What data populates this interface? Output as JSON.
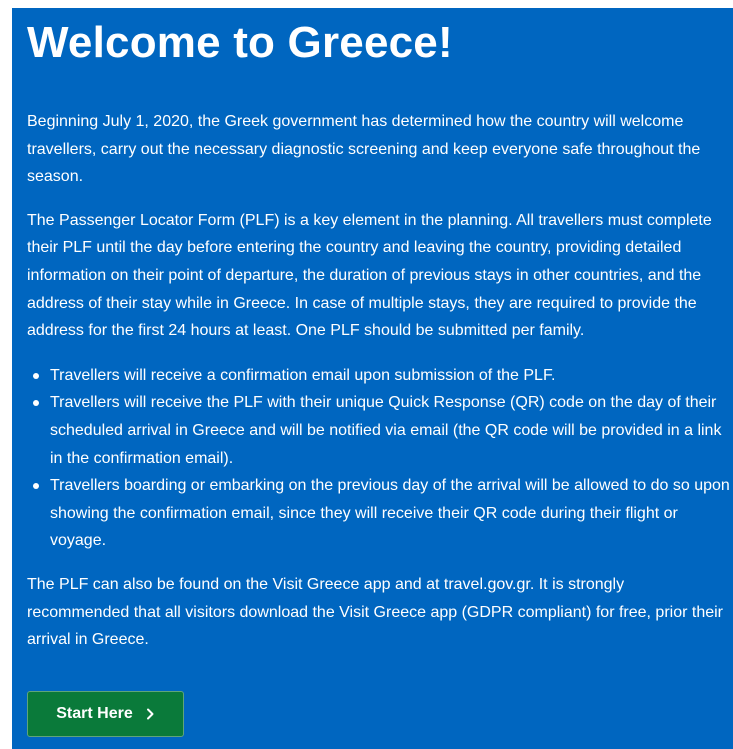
{
  "page": {
    "title": "Welcome to Greece!",
    "paragraphs": [
      "Beginning July 1, 2020, the Greek government has determined how the country will welcome travellers, carry out the necessary diagnostic screening and keep everyone safe throughout the season.",
      "The Passenger Locator Form (PLF) is a key element in the planning. All travellers must complete their PLF until the day before entering the country and leaving the country, providing detailed information on their point of departure, the duration of previous stays in other countries, and the address of their stay while in Greece. In case of multiple stays, they are required to provide the address for the first 24 hours at least. One PLF should be submitted per family.",
      "The PLF can also be found on the Visit Greece app and at travel.gov.gr. It is strongly recommended that all visitors download the Visit Greece app (GDPR compliant) for free, prior their arrival in Greece."
    ],
    "bullets": [
      "Travellers will receive a confirmation email upon submission of the PLF.",
      "Travellers will receive the PLF with their unique Quick Response (QR) code on the day of their scheduled arrival in Greece and will be notified via email (the QR code will be provided in a link in the confirmation email).",
      "Travellers boarding or embarking on the previous day of the arrival will be allowed to do so upon showing the confirmation email, since they will receive their QR code during their flight or voyage."
    ],
    "start_button_label": "Start Here",
    "start_button_icon": "chevron-right-icon"
  },
  "colors": {
    "panel_bg": "#0066c0",
    "button_bg": "#0a7a3a",
    "text": "#ffffff"
  }
}
